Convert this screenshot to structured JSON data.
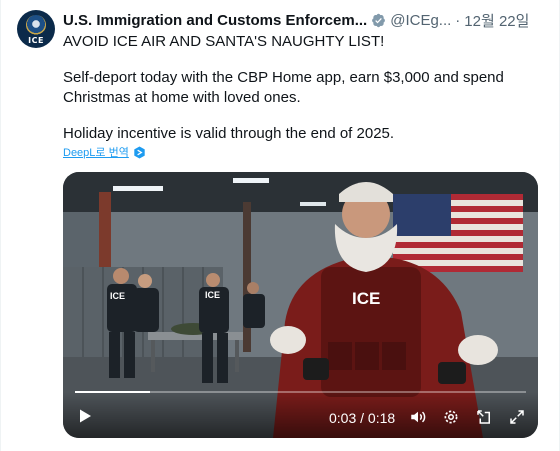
{
  "header": {
    "display_name": "U.S. Immigration and Customs Enforcem...",
    "handle": "@ICEg...",
    "separator": "·",
    "date": "12월 22일"
  },
  "avatar": {
    "label": "ICE"
  },
  "body": {
    "line1": "AVOID ICE AIR AND SANTA'S NAUGHTY LIST!",
    "line2": "Self-deport today with the CBP Home app, earn $3,000 and spend Christmas at home with loved ones.",
    "line4": "Holiday incentive is valid through the end of 2025."
  },
  "translate": {
    "label": "DeepL로 번역"
  },
  "video": {
    "time": "0:03 / 0:18",
    "progress": 0.1667
  },
  "icons": {
    "verified": "verified-badge-icon",
    "grok": "grok-icon",
    "more": "more-icon",
    "play": "play-icon",
    "volume": "volume-icon",
    "settings": "settings-icon",
    "exit": "exit-icon",
    "fullscreen": "fullscreen-icon"
  },
  "colors": {
    "accent": "#1d9bf0",
    "text": "#0f1419",
    "secondary": "#536471",
    "verified_badge": "#829aab"
  }
}
